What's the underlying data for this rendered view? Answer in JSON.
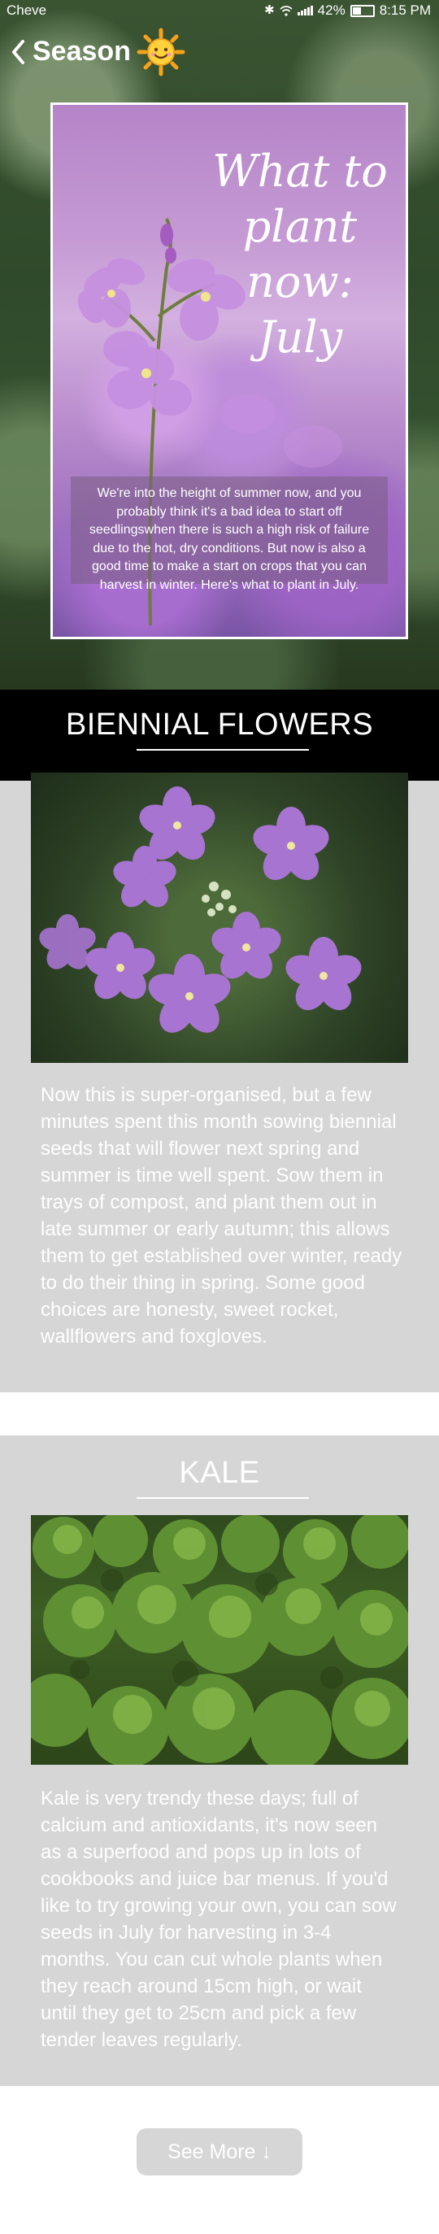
{
  "status_bar": {
    "carrier": "Cheve",
    "battery_percent": "42%",
    "time": "8:15 PM"
  },
  "header": {
    "title": "Season",
    "back_icon": "chevron-left-icon",
    "sun_icon": "smiling-sun-icon"
  },
  "hero": {
    "title": "What to plant now: July",
    "body": "We're into the height of summer now, and you probably think it's a bad idea to start off seedlingswhen there is such a high risk of failure due to the hot, dry conditions. But now is also a good time to make a start on crops that you can harvest in winter.  Here's what to plant in July."
  },
  "sections": [
    {
      "title": "BIENNIAL FLOWERS",
      "body": "Now this is super-organised, but a few minutes spent this month sowing biennial seeds that will flower next spring and summer is time well spent. Sow them in trays of compost, and plant them out in late summer or early autumn; this allows them to get established over winter, ready to do their thing in spring.  Some good choices are honesty, sweet rocket, wallflowers and foxgloves."
    },
    {
      "title": "KALE",
      "body": "Kale is very trendy these days; full of calcium and antioxidants, it's now seen as a superfood and pops up in lots of cookbooks and juice bar menus.  If you'd like to try growing your own, you can sow seeds in July for harvesting in 3-4 months.  You can cut whole plants when they reach around 15cm high, or wait until they get to 25cm and pick a few tender leaves regularly."
    }
  ],
  "see_more": {
    "label": "See More",
    "arrow": "↓"
  },
  "colors": {
    "section_bg": "#d6d6d6",
    "header_bar": "#000000",
    "text": "#ffffff"
  }
}
